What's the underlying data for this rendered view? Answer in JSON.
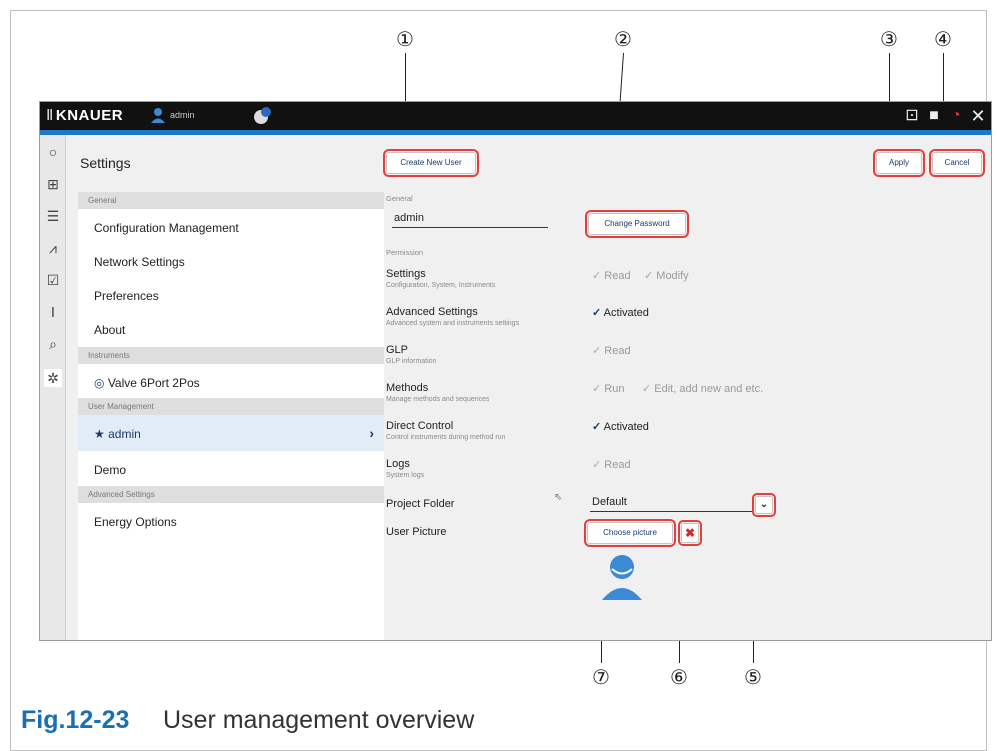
{
  "callouts": [
    "①",
    "②",
    "③",
    "④",
    "⑤",
    "⑥",
    "⑦"
  ],
  "caption": {
    "figure": "Fig.12-23",
    "text": "User management overview"
  },
  "topbar": {
    "brand": "KNAUER",
    "username": "admin"
  },
  "settings_title": "Settings",
  "menu": {
    "general_header": "General",
    "items_general": [
      "Configuration Management",
      "Network Settings",
      "Preferences",
      "About"
    ],
    "instruments_header": "Instruments",
    "instrument_item": "Valve 6Port 2Pos",
    "user_mgmt_header": "User Management",
    "user_selected": "admin",
    "user_other": "Demo",
    "advanced_header": "Advanced Settings",
    "advanced_item": "Energy Options"
  },
  "buttons": {
    "create_new_user": "Create New User",
    "apply": "Apply",
    "cancel": "Cancel",
    "change_password": "Change Password",
    "choose_picture": "Choose picture"
  },
  "form": {
    "general_label": "General",
    "username_value": "admin",
    "permission_label": "Permission",
    "settings_label": "Settings",
    "settings_sub": "Configuration, System, Instruments",
    "settings_read": "Read",
    "settings_modify": "Modify",
    "adv_label": "Advanced Settings",
    "adv_sub": "Advanced system and instruments settings",
    "adv_activated": "Activated",
    "glp_label": "GLP",
    "glp_sub": "GLP information",
    "glp_read": "Read",
    "methods_label": "Methods",
    "methods_sub": "Manage methods and sequences",
    "methods_run": "Run",
    "methods_edit": "Edit, add new and etc.",
    "direct_label": "Direct Control",
    "direct_sub": "Control instruments during method run",
    "direct_activated": "Activated",
    "logs_label": "Logs",
    "logs_sub": "System logs",
    "logs_read": "Read",
    "project_label": "Project Folder",
    "project_value": "Default",
    "picture_label": "User Picture"
  },
  "colors": {
    "accent": "#1f77c7",
    "highlight": "#e0413d",
    "navy": "#1a3a6e",
    "caption_blue": "#1a6fb0"
  }
}
